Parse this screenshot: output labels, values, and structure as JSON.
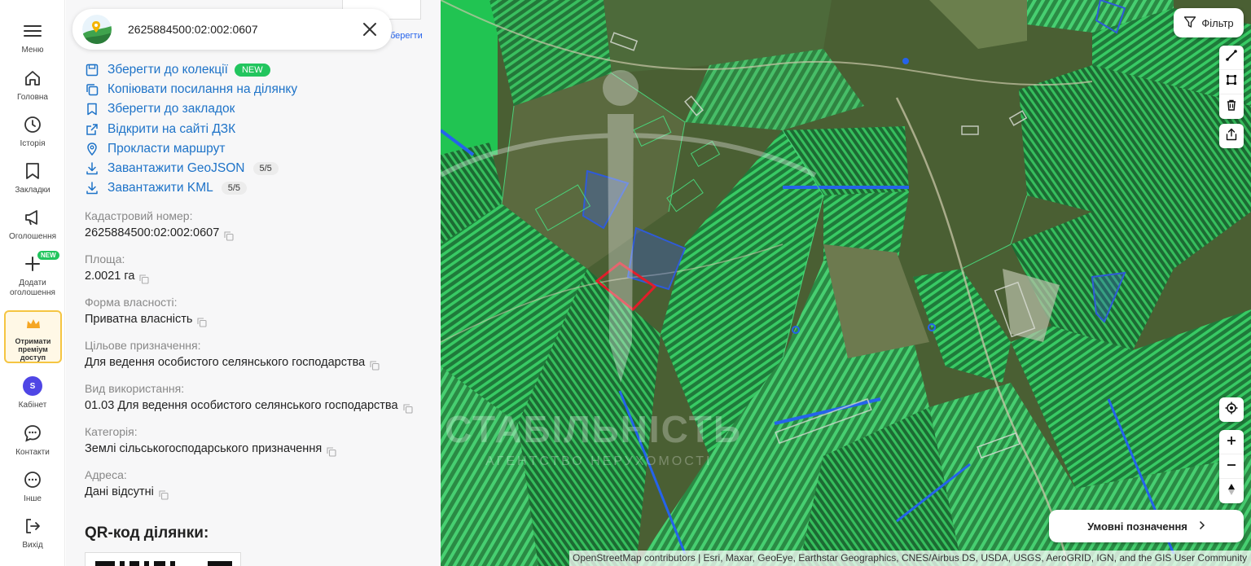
{
  "nav": {
    "menu": "Меню",
    "home": "Головна",
    "history": "Історія",
    "bookmarks": "Закладки",
    "ads": "Оголошення",
    "add_ad": "Додати оголошення",
    "add_ad_badge": "NEW",
    "premium": "Отримати преміум доступ",
    "avatar_letter": "S",
    "cabinet": "Кабінет",
    "contacts": "Контакти",
    "other": "Інше",
    "logout": "Вихід"
  },
  "search": {
    "value": "2625884500:02:002:0607",
    "behind_link": "берегти"
  },
  "actions": {
    "save_collection": "Зберегти до колекції",
    "save_collection_badge": "NEW",
    "copy_link": "Копіювати посилання на ділянку",
    "save_bookmark": "Зберегти до закладок",
    "open_dzk": "Відкрити на сайті ДЗК",
    "route": "Прокласти маршрут",
    "geojson": "Завантажити GeoJSON",
    "geojson_count": "5/5",
    "kml": "Завантажити KML",
    "kml_count": "5/5"
  },
  "fields": [
    {
      "label": "Кадастровий номер:",
      "value": "2625884500:02:002:0607"
    },
    {
      "label": "Площа:",
      "value": "2.0021 га"
    },
    {
      "label": "Форма власності:",
      "value": "Приватна власність"
    },
    {
      "label": "Цільове призначення:",
      "value": "Для ведення особистого селянського господарства"
    },
    {
      "label": "Вид використання:",
      "value": "01.03 Для ведення особистого селянського господарства"
    },
    {
      "label": "Категорія:",
      "value": "Землі сільськогосподарського призначення"
    },
    {
      "label": "Адреса:",
      "value": "Дані відсутні"
    }
  ],
  "qr_title": "QR-код ділянки:",
  "map": {
    "filter": "Фільтр",
    "legend": "Умовні позначення",
    "watermark": "СТАБІЛЬНІСТЬ",
    "watermark_sub": "АГЕНТСТВО НЕРУХОМОСТІ",
    "attribution": "OpenStreetMap contributors | Esri, Maxar, GeoEye, Earthstar Geographics, CNES/Airbus DS, USDA, USGS, AeroGRID, IGN, and the GIS User Community",
    "colors": {
      "parcel_green": "#22c55e",
      "parcel_blue": "#2563eb",
      "selected": "#e11d2a"
    }
  }
}
